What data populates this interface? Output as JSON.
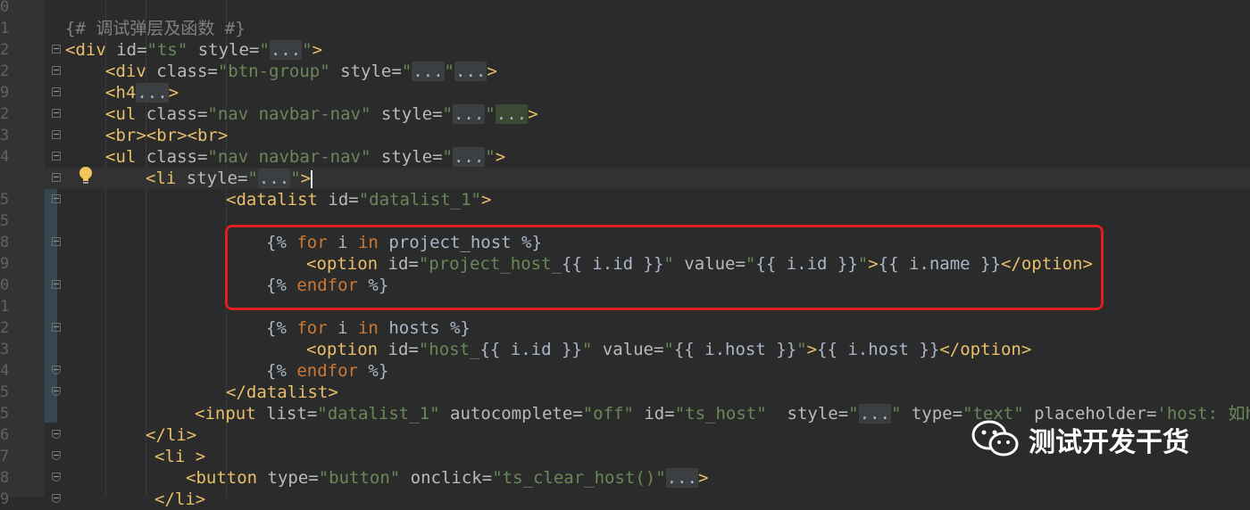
{
  "editor": {
    "line_numbers": [
      "0",
      "1",
      "2",
      "2",
      "9",
      "2",
      "3",
      "4",
      "5",
      "5",
      "5",
      "8",
      "9",
      "0",
      "1",
      "2",
      "3",
      "4",
      "5",
      "5",
      "6",
      "7",
      "8",
      "9"
    ],
    "lines": [
      {
        "segments": [
          {
            "c": "cmt",
            "t": "{# 调试弹层及函数 #}"
          }
        ]
      },
      {
        "segments": [
          {
            "c": "tag",
            "t": "<div "
          },
          {
            "c": "attr",
            "t": "id="
          },
          {
            "c": "str",
            "t": "\"ts\""
          },
          {
            "c": "attr",
            "t": " style="
          },
          {
            "c": "str",
            "t": "\""
          },
          {
            "c": "dots",
            "t": "..."
          },
          {
            "c": "str",
            "t": "\""
          },
          {
            "c": "tag",
            "t": ">"
          }
        ]
      },
      {
        "segments": [
          {
            "c": "tag",
            "t": "<div "
          },
          {
            "c": "attr",
            "t": "class="
          },
          {
            "c": "str",
            "t": "\"btn-group\""
          },
          {
            "c": "attr",
            "t": " style="
          },
          {
            "c": "str",
            "t": "\""
          },
          {
            "c": "dots",
            "t": "..."
          },
          {
            "c": "str",
            "t": "\""
          },
          {
            "c": "dots",
            "t": "..."
          },
          {
            "c": "tag",
            "t": ">"
          }
        ]
      },
      {
        "segments": [
          {
            "c": "tag",
            "t": "<h4"
          },
          {
            "c": "dots",
            "t": "..."
          },
          {
            "c": "tag",
            "t": ">"
          }
        ]
      },
      {
        "segments": [
          {
            "c": "tag",
            "t": "<ul "
          },
          {
            "c": "attr",
            "t": "class="
          },
          {
            "c": "str",
            "t": "\"nav navbar-nav\""
          },
          {
            "c": "attr",
            "t": " style="
          },
          {
            "c": "str",
            "t": "\""
          },
          {
            "c": "dots",
            "t": "..."
          },
          {
            "c": "str",
            "t": "\""
          },
          {
            "c": "dotsg",
            "t": "..."
          },
          {
            "c": "tag",
            "t": ">"
          }
        ]
      },
      {
        "segments": [
          {
            "c": "tag",
            "t": "<br><br><br>"
          }
        ]
      },
      {
        "segments": [
          {
            "c": "tag",
            "t": "<ul "
          },
          {
            "c": "attr",
            "t": "class="
          },
          {
            "c": "str",
            "t": "\"nav navbar-nav\""
          },
          {
            "c": "attr",
            "t": " style="
          },
          {
            "c": "str",
            "t": "\""
          },
          {
            "c": "dots",
            "t": "..."
          },
          {
            "c": "str",
            "t": "\""
          },
          {
            "c": "tag",
            "t": ">"
          }
        ]
      },
      {
        "segments": [
          {
            "c": "tag",
            "t": "<li "
          },
          {
            "c": "attr",
            "t": "style="
          },
          {
            "c": "str",
            "t": "\""
          },
          {
            "c": "dots",
            "t": "..."
          },
          {
            "c": "str",
            "t": "\""
          },
          {
            "c": "tag",
            "t": ">"
          }
        ]
      },
      {
        "segments": [
          {
            "c": "tag",
            "t": "<datalist "
          },
          {
            "c": "attr",
            "t": "id="
          },
          {
            "c": "str",
            "t": "\"datalist_1\""
          },
          {
            "c": "tag",
            "t": ">"
          }
        ]
      },
      {
        "segments": []
      },
      {
        "segments": [
          {
            "c": "tmpl",
            "t": "{% "
          },
          {
            "c": "kw",
            "t": "for"
          },
          {
            "c": "tmpl",
            "t": " i "
          },
          {
            "c": "kw",
            "t": "in"
          },
          {
            "c": "tmpl",
            "t": " project_host %}"
          }
        ]
      },
      {
        "segments": [
          {
            "c": "tag",
            "t": "<option "
          },
          {
            "c": "attr",
            "t": "id="
          },
          {
            "c": "str",
            "t": "\"project_host_"
          },
          {
            "c": "tmpl",
            "t": "{{ i.id }}"
          },
          {
            "c": "str",
            "t": "\""
          },
          {
            "c": "attr",
            "t": " value="
          },
          {
            "c": "str",
            "t": "\""
          },
          {
            "c": "tmpl",
            "t": "{{ i.id }}"
          },
          {
            "c": "str",
            "t": "\""
          },
          {
            "c": "tag",
            "t": ">"
          },
          {
            "c": "tmpl",
            "t": "{{ i.name }}"
          },
          {
            "c": "tag",
            "t": "</option>"
          }
        ]
      },
      {
        "segments": [
          {
            "c": "tmpl",
            "t": "{% "
          },
          {
            "c": "kw",
            "t": "endfor"
          },
          {
            "c": "tmpl",
            "t": " %}"
          }
        ]
      },
      {
        "segments": []
      },
      {
        "segments": [
          {
            "c": "tmpl",
            "t": "{% "
          },
          {
            "c": "kw",
            "t": "for"
          },
          {
            "c": "tmpl",
            "t": " i "
          },
          {
            "c": "kw",
            "t": "in"
          },
          {
            "c": "tmpl",
            "t": " hosts %}"
          }
        ]
      },
      {
        "segments": [
          {
            "c": "tag",
            "t": "<option "
          },
          {
            "c": "attr",
            "t": "id="
          },
          {
            "c": "str",
            "t": "\"host_"
          },
          {
            "c": "tmpl",
            "t": "{{ i.id }}"
          },
          {
            "c": "str",
            "t": "\""
          },
          {
            "c": "attr",
            "t": " value="
          },
          {
            "c": "str",
            "t": "\""
          },
          {
            "c": "tmpl",
            "t": "{{ i.host }}"
          },
          {
            "c": "str",
            "t": "\""
          },
          {
            "c": "tag",
            "t": ">"
          },
          {
            "c": "tmpl",
            "t": "{{ i.host }}"
          },
          {
            "c": "tag",
            "t": "</option>"
          }
        ]
      },
      {
        "segments": [
          {
            "c": "tmpl",
            "t": "{% "
          },
          {
            "c": "kw",
            "t": "endfor"
          },
          {
            "c": "tmpl",
            "t": " %}"
          }
        ]
      },
      {
        "segments": [
          {
            "c": "tag",
            "t": "</datalist>"
          }
        ]
      },
      {
        "segments": [
          {
            "c": "tag",
            "t": "<input "
          },
          {
            "c": "attr",
            "t": "list="
          },
          {
            "c": "str",
            "t": "\"datalist_1\""
          },
          {
            "c": "attr",
            "t": " autocomplete="
          },
          {
            "c": "str",
            "t": "\"off\""
          },
          {
            "c": "attr",
            "t": " id="
          },
          {
            "c": "str",
            "t": "\"ts_host\""
          },
          {
            "c": "attr",
            "t": "  style="
          },
          {
            "c": "str",
            "t": "\""
          },
          {
            "c": "dots",
            "t": "..."
          },
          {
            "c": "str",
            "t": "\""
          },
          {
            "c": "attr",
            "t": " type="
          },
          {
            "c": "str",
            "t": "\"text\""
          },
          {
            "c": "attr",
            "t": " placeholder="
          },
          {
            "c": "str",
            "t": "'host: 如htt"
          }
        ]
      },
      {
        "segments": [
          {
            "c": "tag",
            "t": "</li>"
          }
        ]
      },
      {
        "segments": [
          {
            "c": "tag",
            "t": "<li >"
          }
        ]
      },
      {
        "segments": [
          {
            "c": "tag",
            "t": "<button "
          },
          {
            "c": "attr",
            "t": "type="
          },
          {
            "c": "str",
            "t": "\"button\""
          },
          {
            "c": "attr",
            "t": " onclick="
          },
          {
            "c": "str",
            "t": "\"ts_clear_host()\""
          },
          {
            "c": "dots",
            "t": "..."
          },
          {
            "c": "tag",
            "t": ">"
          }
        ]
      },
      {
        "segments": [
          {
            "c": "tag",
            "t": "</li>"
          }
        ]
      }
    ]
  },
  "watermark": {
    "text": "测试开发干货",
    "icon": "wechat-icon"
  },
  "colors": {
    "highlight_box": "#e01e1e",
    "background": "#2b2b2b"
  }
}
